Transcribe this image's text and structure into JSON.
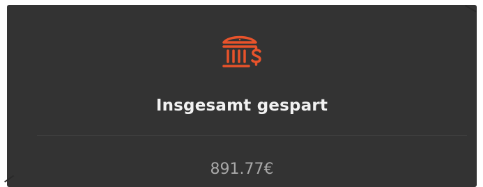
{
  "card": {
    "title": "Insgesamt gespart",
    "value": "891.77€",
    "icon": "bank-dollar-icon"
  },
  "colors": {
    "card_background": "#333333",
    "accent": "#e8532b",
    "title_text": "#f2f2f2",
    "value_text": "#a8a8a8"
  }
}
